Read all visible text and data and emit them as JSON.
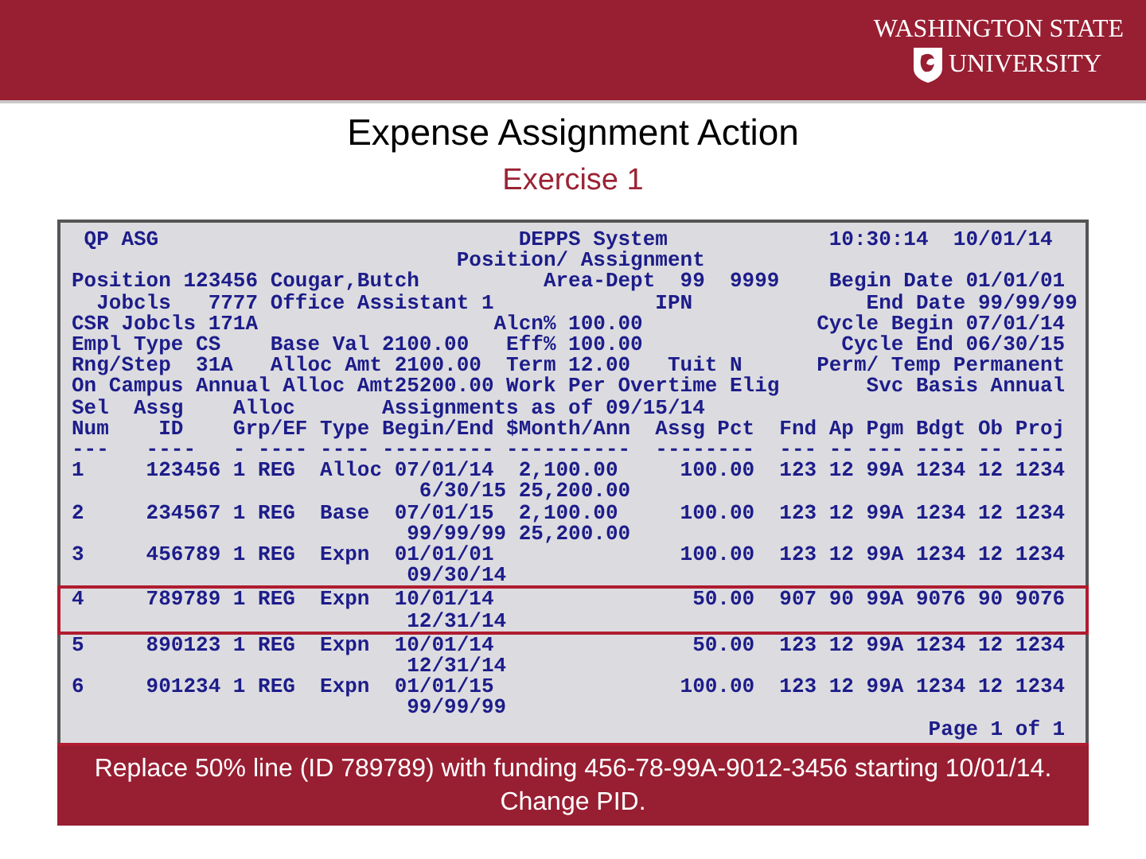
{
  "header": {
    "logo_line1": "WASHINGTON STATE",
    "logo_line2": "UNIVERSITY"
  },
  "title": "Expense Assignment Action",
  "subtitle": "Exercise 1",
  "terminal": {
    "lines": [
      {
        "text": " QP ASG                             DEPPS System             10:30:14  10/01/14",
        "selected": false
      },
      {
        "text": "                               Position/ Assignment",
        "selected": false
      },
      {
        "text": "Position 123456 Cougar,Butch          Area-Dept  99  9999    Begin Date 01/01/01",
        "selected": false
      },
      {
        "text": "  Jobcls   7777 Office Assistant 1             IPN              End Date 99/99/99",
        "selected": false
      },
      {
        "text": "CSR Jobcls 171A                   Alcn% 100.00              Cycle Begin 07/01/14",
        "selected": false
      },
      {
        "text": "Empl Type CS    Base Val 2100.00   Eff% 100.00                Cycle End 06/30/15",
        "selected": false
      },
      {
        "text": "Rng/Step  31A   Alloc Amt 2100.00  Term 12.00   Tuit N      Perm/ Temp Permanent",
        "selected": false
      },
      {
        "text": "On Campus Annual Alloc Amt25200.00 Work Per Overtime Elig       Svc Basis Annual",
        "selected": false
      },
      {
        "text": "Sel  Assg    Alloc       Assignments as of 09/15/14",
        "selected": false
      },
      {
        "text": "Num    ID    Grp/EF Type Begin/End $Month/Ann  Assg Pct  Fnd Ap Pgm Bdgt Ob Proj",
        "selected": false
      },
      {
        "text": "---   ----   - ---- ---- --------- ----------  --------  --- -- --- ---- -- ----",
        "selected": false
      },
      {
        "text": "1     123456 1 REG  Alloc 07/01/14  2,100.00     100.00  123 12 99A 1234 12 1234",
        "selected": false
      },
      {
        "text": "                            6/30/15 25,200.00",
        "selected": false
      },
      {
        "text": "2     234567 1 REG  Base  07/01/15  2,100.00     100.00  123 12 99A 1234 12 1234",
        "selected": false
      },
      {
        "text": "                           99/99/99 25,200.00",
        "selected": false
      },
      {
        "text": "3     456789 1 REG  Expn  01/01/01               100.00  123 12 99A 1234 12 1234",
        "selected": false
      },
      {
        "text": "                           09/30/14",
        "selected": false
      },
      {
        "text": "4     789789 1 REG  Expn  10/01/14                50.00  907 90 99A 9076 90 9076",
        "selected": true
      },
      {
        "text": "                           12/31/14",
        "selected": true
      },
      {
        "text": "5     890123 1 REG  Expn  10/01/14                50.00  123 12 99A 1234 12 1234",
        "selected": false
      },
      {
        "text": "                           12/31/14",
        "selected": false
      },
      {
        "text": "6     901234 1 REG  Expn  01/01/15               100.00  123 12 99A 1234 12 1234",
        "selected": false
      },
      {
        "text": "                           99/99/99",
        "selected": false
      },
      {
        "text": "                                                                     Page 1 of 1",
        "selected": false
      }
    ]
  },
  "caption": "Replace 50% line (ID 789789) with funding 456-78-99A-9012-3456 starting 10/01/14. Change PID."
}
